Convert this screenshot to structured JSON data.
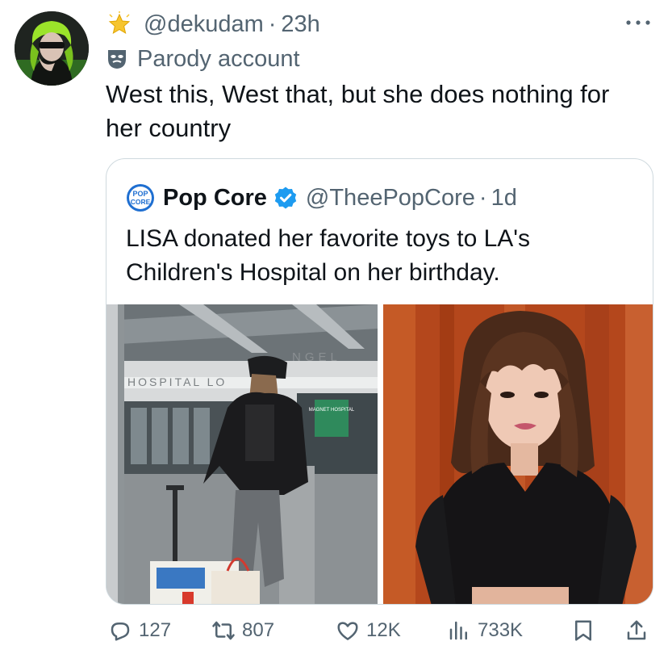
{
  "tweet": {
    "handle": "@dekudam",
    "separator": "·",
    "time": "23h",
    "parody_label": "Parody account",
    "text": "West this, West that, but she does nothing for her country"
  },
  "quote": {
    "name": "Pop Core",
    "handle": "@TheePopCore",
    "separator": "·",
    "time": "1d",
    "text": "LISA donated her favorite toys to LA's Children's Hospital on her birthday.",
    "logo_text_top": "POP",
    "logo_text_bottom": "CORE",
    "sign_left": "HOSPITAL LO",
    "sign_right": "NGEL",
    "green_sign": "MAGNET HOSPITAL"
  },
  "actions": {
    "replies": "127",
    "reposts": "807",
    "likes": "12K",
    "views": "733K"
  },
  "icons": {
    "badge": "star-badge-icon",
    "parody": "mask-icon",
    "more": "more-icon",
    "verified": "verified-badge-icon",
    "reply": "reply-icon",
    "repost": "repost-icon",
    "like": "heart-icon",
    "views": "views-icon",
    "bookmark": "bookmark-icon",
    "share": "share-icon"
  },
  "colors": {
    "text": "#0f1419",
    "muted": "#536471",
    "verified": "#1d9bf0",
    "border": "#cfd9de"
  }
}
